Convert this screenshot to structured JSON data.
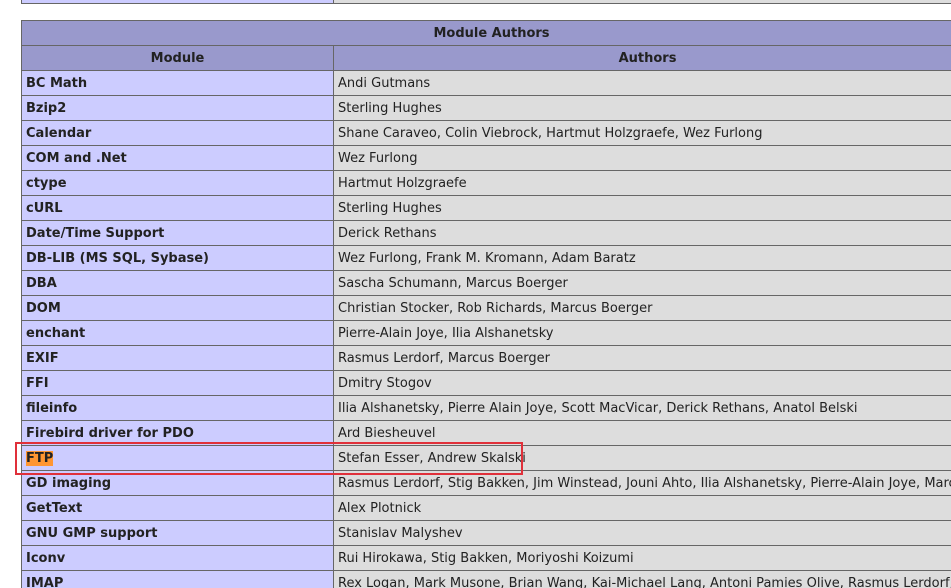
{
  "table": {
    "caption": "Module Authors",
    "headers": [
      "Module",
      "Authors"
    ],
    "rows": [
      {
        "module": "BC Math",
        "authors": "Andi Gutmans"
      },
      {
        "module": "Bzip2",
        "authors": "Sterling Hughes"
      },
      {
        "module": "Calendar",
        "authors": "Shane Caraveo, Colin Viebrock, Hartmut Holzgraefe, Wez Furlong"
      },
      {
        "module": "COM and .Net",
        "authors": "Wez Furlong"
      },
      {
        "module": "ctype",
        "authors": "Hartmut Holzgraefe"
      },
      {
        "module": "cURL",
        "authors": "Sterling Hughes"
      },
      {
        "module": "Date/Time Support",
        "authors": "Derick Rethans"
      },
      {
        "module": "DB-LIB (MS SQL, Sybase)",
        "authors": "Wez Furlong, Frank M. Kromann, Adam Baratz"
      },
      {
        "module": "DBA",
        "authors": "Sascha Schumann, Marcus Boerger"
      },
      {
        "module": "DOM",
        "authors": "Christian Stocker, Rob Richards, Marcus Boerger"
      },
      {
        "module": "enchant",
        "authors": "Pierre-Alain Joye, Ilia Alshanetsky"
      },
      {
        "module": "EXIF",
        "authors": "Rasmus Lerdorf, Marcus Boerger"
      },
      {
        "module": "FFI",
        "authors": "Dmitry Stogov"
      },
      {
        "module": "fileinfo",
        "authors": "Ilia Alshanetsky, Pierre Alain Joye, Scott MacVicar, Derick Rethans, Anatol Belski"
      },
      {
        "module": "Firebird driver for PDO",
        "authors": "Ard Biesheuvel"
      },
      {
        "module": "FTP",
        "authors": "Stefan Esser, Andrew Skalski",
        "highlighted": true
      },
      {
        "module": "GD imaging",
        "authors": "Rasmus Lerdorf, Stig Bakken, Jim Winstead, Jouni Ahto, Ilia Alshanetsky, Pierre-Alain Joye, Marcus Boerger"
      },
      {
        "module": "GetText",
        "authors": "Alex Plotnick"
      },
      {
        "module": "GNU GMP support",
        "authors": "Stanislav Malyshev"
      },
      {
        "module": "Iconv",
        "authors": "Rui Hirokawa, Stig Bakken, Moriyoshi Koizumi"
      },
      {
        "module": "IMAP",
        "authors": "Rex Logan, Mark Musone, Brian Wang, Kai-Michael Lang, Antoni Pamies Olive, Rasmus Lerdorf, Andrew"
      }
    ]
  },
  "colors": {
    "header_bg": "#9999cc",
    "key_bg": "#ccccff",
    "value_bg": "#dddddd",
    "search_highlight": "#ff9632",
    "annotation_box": "#e0303a"
  }
}
